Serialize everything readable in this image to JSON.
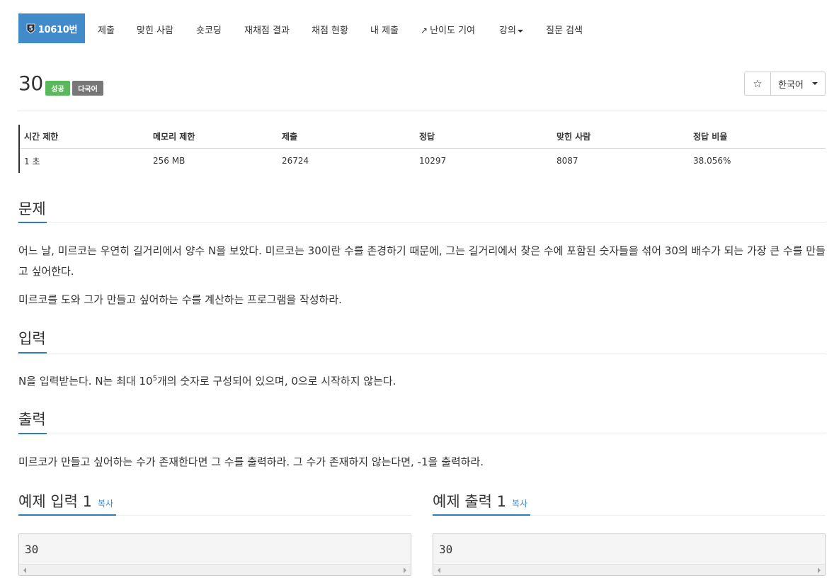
{
  "nav": {
    "problem_tier": "5",
    "problem_label": "10610번",
    "items": [
      "제출",
      "맞힌 사람",
      "숏코딩",
      "재채점 결과",
      "채점 현황",
      "내 제출",
      "난이도 기여",
      "강의",
      "질문 검색"
    ]
  },
  "problem": {
    "title": "30",
    "status_badge": "성공",
    "lang_badge": "다국어",
    "star": "☆",
    "language_select": "한국어"
  },
  "info": {
    "headers": [
      "시간 제한",
      "메모리 제한",
      "제출",
      "정답",
      "맞힌 사람",
      "정답 비율"
    ],
    "values": [
      "1 초",
      "256 MB",
      "26724",
      "10297",
      "8087",
      "38.056%"
    ]
  },
  "sections": {
    "problem_heading": "문제",
    "problem_p1": "어느 날, 미르코는 우연히 길거리에서 양수 N을 보았다. 미르코는 30이란 수를 존경하기 때문에, 그는 길거리에서 찾은 수에 포함된 숫자들을 섞어 30의 배수가 되는 가장 큰 수를 만들고 싶어한다.",
    "problem_p2": "미르코를 도와 그가 만들고 싶어하는 수를 계산하는 프로그램을 작성하라.",
    "input_heading": "입력",
    "input_p_before": "N을 입력받는다. N는 최대 10",
    "input_p_sup": "5",
    "input_p_after": "개의 숫자로 구성되어 있으며, 0으로 시작하지 않는다.",
    "output_heading": "출력",
    "output_p": "미르코가 만들고 싶어하는 수가 존재한다면 그 수를 출력하라. 그 수가 존재하지 않는다면, -1을 출력하라."
  },
  "samples": {
    "input_heading": "예제 입력 1",
    "output_heading": "예제 출력 1",
    "copy_label": "복사",
    "input_value": "30",
    "output_value": "30"
  },
  "colors": {
    "accent": "#428bca",
    "success": "#5cb85c",
    "lang_badge": "#777777",
    "section_underline": "#2c7cc4"
  }
}
